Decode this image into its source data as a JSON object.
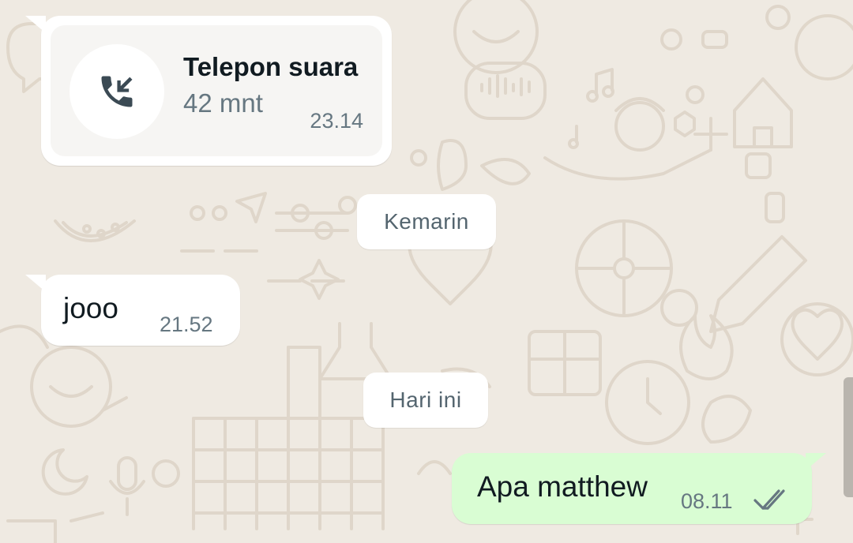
{
  "colors": {
    "wallpaper": "#efeae2",
    "incoming_bubble": "#ffffff",
    "outgoing_bubble": "#d9fdd3",
    "read_ticks": "#667781"
  },
  "call_message": {
    "icon": "incoming-call-icon",
    "title": "Telepon suara",
    "duration": "42 mnt",
    "time": "23.14"
  },
  "date_separators": {
    "yesterday": "Kemarin",
    "today": "Hari ini"
  },
  "messages": [
    {
      "direction": "incoming",
      "text": "jooo",
      "time": "21.52"
    },
    {
      "direction": "outgoing",
      "text": "Apa matthew",
      "time": "08.11",
      "status": "read-double-check-icon"
    }
  ]
}
